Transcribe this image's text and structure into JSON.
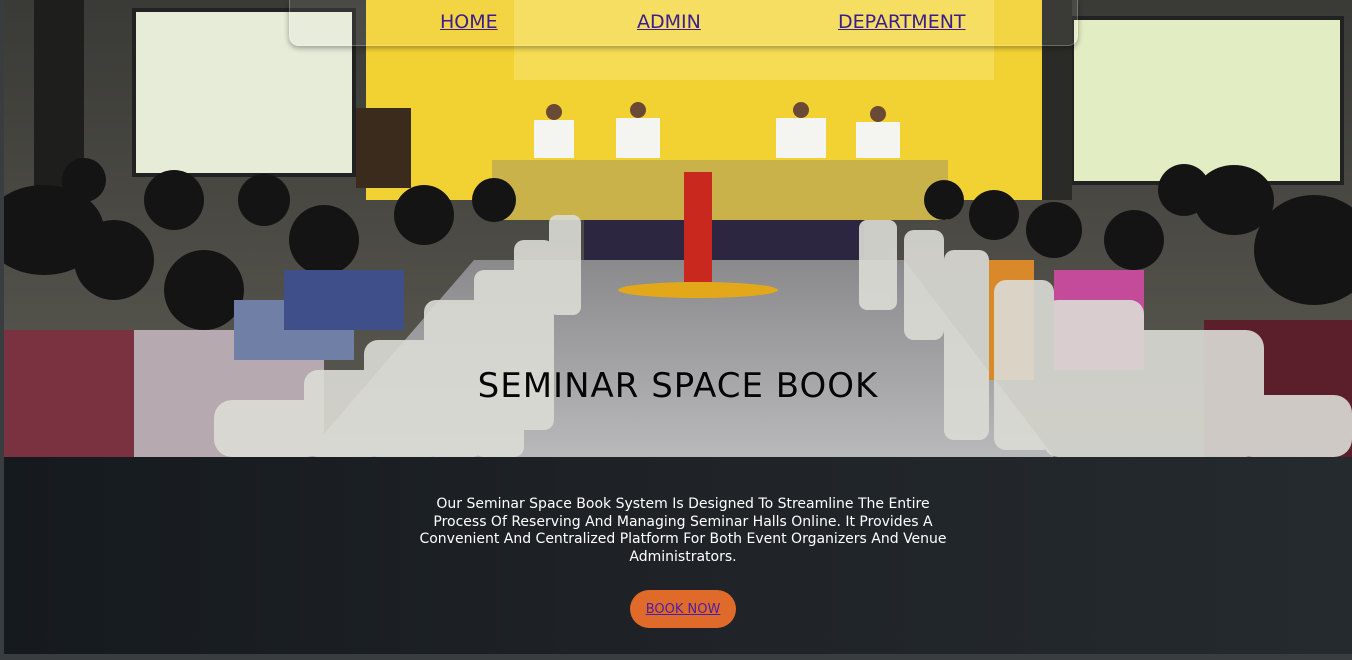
{
  "nav": {
    "home_label": "HOME",
    "admin_label": "ADMIN",
    "department_label": "DEPARTMENT"
  },
  "hero": {
    "title": "SEMINAR SPACE BOOK"
  },
  "intro": {
    "description": "Our Seminar Space Book System Is Designed To Streamline The Entire Process Of Reserving And Managing Seminar Halls Online. It Provides A Convenient And Centralized Platform For Both Event Organizers And Venue Administrators."
  },
  "cta": {
    "book_now_label": "BOOK NOW"
  },
  "colors": {
    "band_bg": "#1f2327",
    "button_bg": "#e06a2a",
    "link_color": "#3b1d8f",
    "stage_backdrop": "#f2d233"
  }
}
